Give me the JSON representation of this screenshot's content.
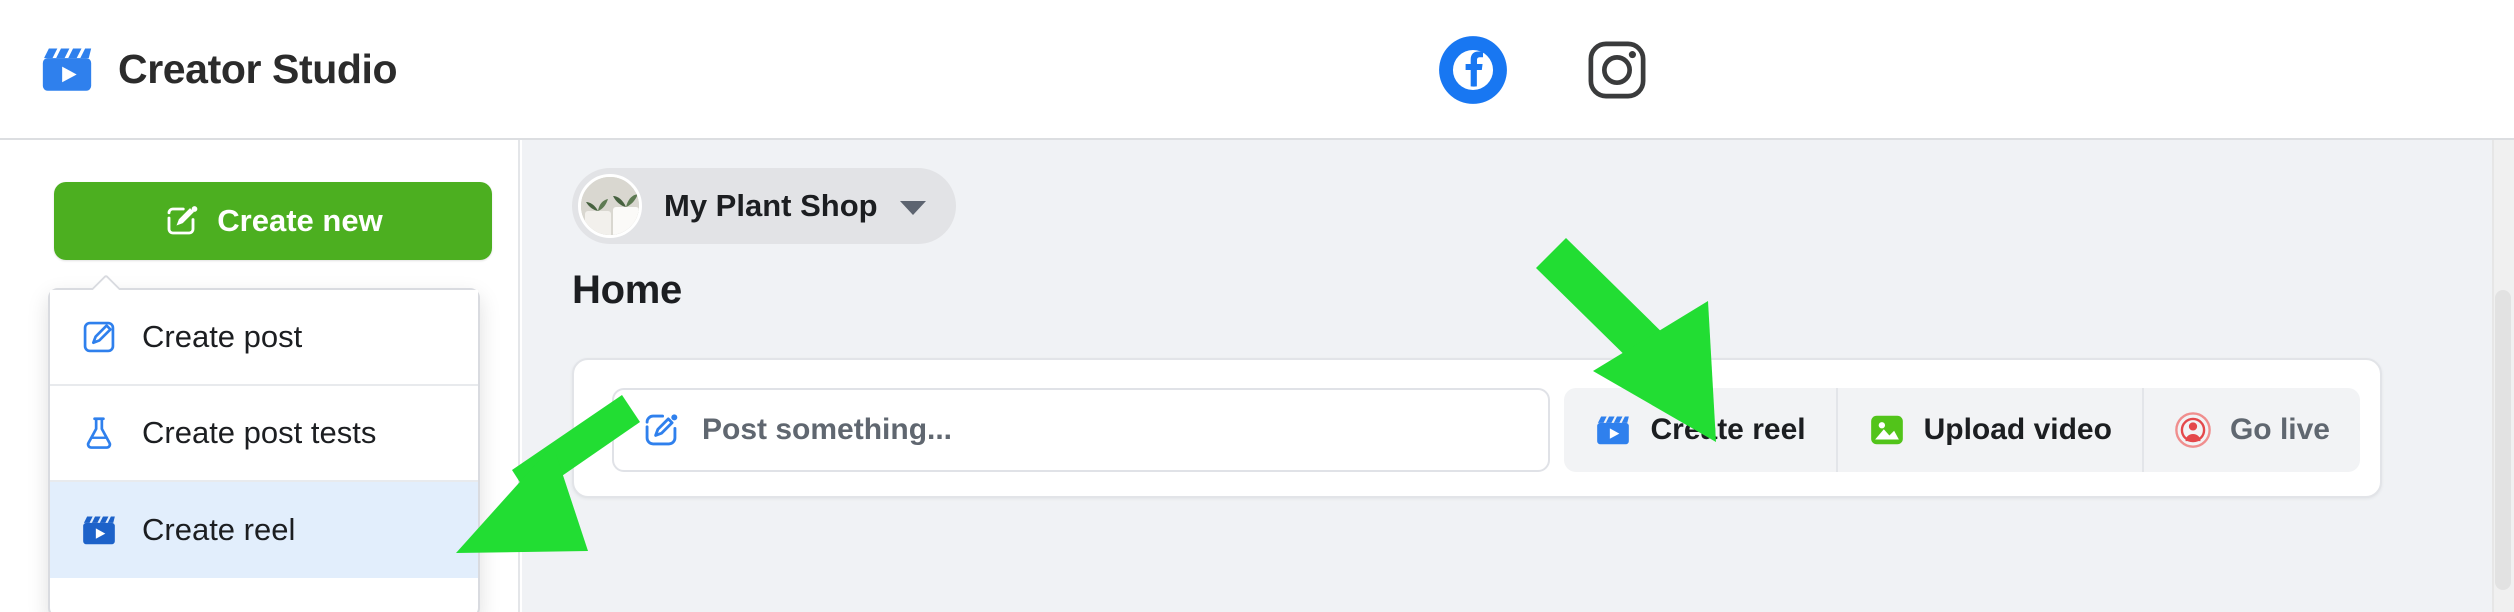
{
  "header": {
    "brand_title": "Creator Studio",
    "brand_logo_icon": "clapperboard-play-icon",
    "platform_tabs": [
      {
        "name": "facebook",
        "icon": "facebook-icon",
        "label": "Facebook",
        "active": true
      },
      {
        "name": "instagram",
        "icon": "instagram-icon",
        "label": "Instagram",
        "active": false
      }
    ]
  },
  "sidebar": {
    "create_new_label": "Create new",
    "create_new_icon": "edit-square-icon",
    "menu": {
      "items": [
        {
          "label": "Create post",
          "icon": "edit-square-icon",
          "selected": false
        },
        {
          "label": "Create post tests",
          "icon": "flask-icon",
          "selected": false
        },
        {
          "label": "Create reel",
          "icon": "clapperboard-play-icon",
          "selected": true
        }
      ]
    }
  },
  "main": {
    "page_selector": {
      "name": "My Plant Shop",
      "avatar_icon": "plant-avatar",
      "chevron_icon": "chevron-down-icon"
    },
    "page_heading": "Home",
    "composer": {
      "placeholder": "Post something...",
      "input_icon": "edit-square-icon",
      "actions": [
        {
          "label": "Create reel",
          "icon": "clapperboard-play-icon",
          "muted": false
        },
        {
          "label": "Upload video",
          "icon": "photo-image-icon",
          "muted": false
        },
        {
          "label": "Go live",
          "icon": "broadcast-live-icon",
          "muted": true
        }
      ]
    }
  },
  "annotations": {
    "arrow_to_create_reel_button": "green-arrow-down-right",
    "arrow_to_create_reel_menu_item": "green-arrow-down-left"
  },
  "colors": {
    "brand_blue": "#1877F2",
    "green_button": "#4CAF20",
    "annotation_green": "#22DD33",
    "selected_menu_bg": "#E2EEFC",
    "live_red": "#E4484B",
    "upload_green": "#52C41A",
    "canvas_bg": "#F0F2F5"
  }
}
